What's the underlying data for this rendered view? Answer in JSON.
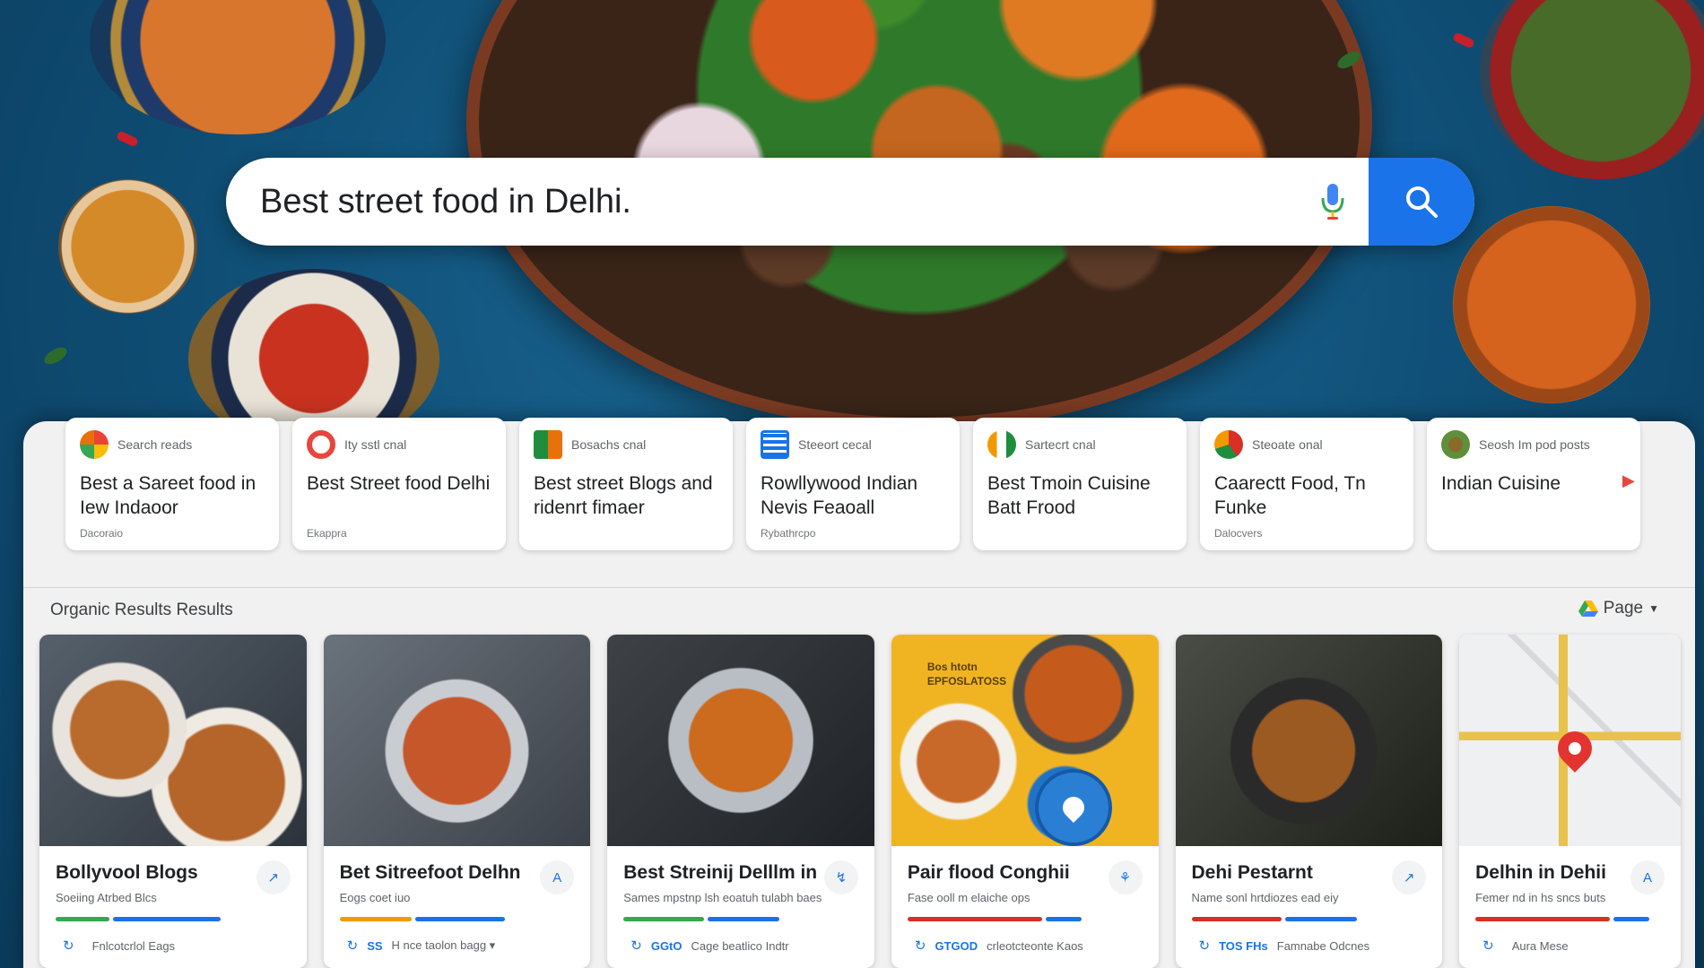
{
  "search": {
    "query": "Best street food in Delhi.",
    "mic_icon": "mic-icon",
    "search_icon": "search-icon"
  },
  "suggestions": [
    {
      "source": "Search reads",
      "title": "Best a Sareet food in Iew Indaoor",
      "meta": "Dacoraio",
      "logo_color": "#34a853"
    },
    {
      "source": "Ity sstl cnal",
      "title": "Best Street food Delhi",
      "meta": "Ekappra",
      "logo_color": "#e8453c"
    },
    {
      "source": "Bosachs cnal",
      "title": "Best street Blogs and ridenrt fimaer",
      "meta": "",
      "logo_color": "#1e8e3e"
    },
    {
      "source": "Steeort cecal",
      "title": "Rowllywood Indian Nevis Feaoall",
      "meta": "Rybathrcpo",
      "logo_color": "#1a73e8"
    },
    {
      "source": "Sartecrt cnal",
      "title": "Best Tmoin Cuisine Batt Frood",
      "meta": "",
      "logo_color": "#f29900"
    },
    {
      "source": "Steoate onal",
      "title": "Caarectt Food, Tn Funke",
      "meta": "Dalocvers",
      "logo_color": "#d93025"
    },
    {
      "source": "Seosh Im pod posts",
      "title": "Indian Cuisine",
      "meta": "",
      "logo_color": "#5f8f3a"
    }
  ],
  "organic": {
    "label": "Organic Results Results",
    "page_label": "Page"
  },
  "results": [
    {
      "title": "Bollyvool Blogs",
      "sub": "Soeiing Atrbed Blcs",
      "action": "↗",
      "foot_bold": "",
      "foot": "Fnlcotcrlol Eags",
      "bars": [
        "#34a853",
        "#1a73e8"
      ]
    },
    {
      "title": "Bet Sitreefoot Delhn",
      "sub": "Eogs coet iuo",
      "action": "A",
      "foot_bold": "SS",
      "foot": "H nce taolon bagg ▾",
      "bars": [
        "#f29900",
        "#1a73e8"
      ]
    },
    {
      "title": "Best Streinij Delllm in",
      "sub": "Sames mpstnp lsh eoatuh tulabh baes",
      "action": "↯",
      "foot_bold": "GGtO",
      "foot": "Cage beatlico Indtr",
      "bars": [
        "#34a853",
        "#1a73e8"
      ]
    },
    {
      "title": "Pair flood Conghii",
      "sub": "Fase ooll m elaiche ops",
      "action": "⚘",
      "foot_bold": "GTGOD",
      "foot": "crleotcteonte Kaos",
      "bars": [
        "#d93025",
        "#1a73e8"
      ],
      "thumb_text": "Bos htotn EPFOSLATOSS"
    },
    {
      "title": "Dehi Pestarnt",
      "sub": "Name sonl hrtdiozes ead eiy",
      "action": "↗",
      "foot_bold": "TOS FHs",
      "foot": "Famnabe Odcnes",
      "bars": [
        "#d93025",
        "#1a73e8"
      ]
    },
    {
      "title": "Delhin in Dehii",
      "sub": "Femer nd in hs sncs buts",
      "action": "A",
      "foot_bold": "",
      "foot": "Aura Mese",
      "bars": [
        "#d93025",
        "#1a73e8"
      ]
    }
  ]
}
